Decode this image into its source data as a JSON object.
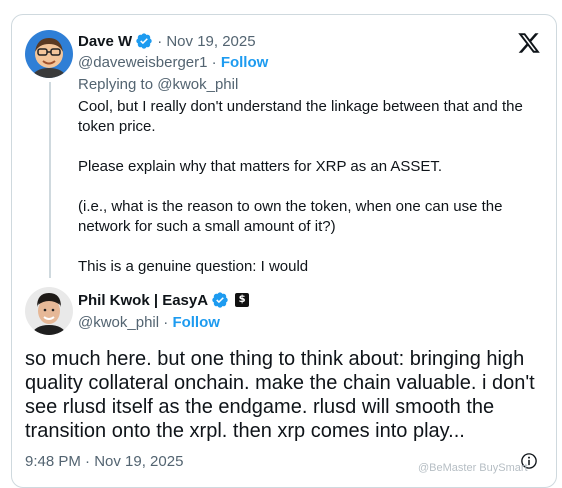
{
  "quoted_post": {
    "author_name": "Dave W",
    "date": "· Nov 19, 2025",
    "handle": "@daveweisberger1",
    "dot": "·",
    "follow_label": "Follow",
    "replying_to": "Replying to @kwok_phil",
    "paragraphs": [
      "Cool, but I really don't understand the linkage between that and the token price.",
      "Please explain why that matters for XRP as an ASSET.",
      "(i.e., what is the reason to own the token, when one can use the network for such a small amount of it?)",
      "This is a genuine question:  I would"
    ]
  },
  "main_post": {
    "author_name": "Phil Kwok | EasyA",
    "affiliate_badge": "$",
    "handle": "@kwok_phil",
    "dot": "·",
    "follow_label": "Follow",
    "text": "so much here. but one thing to think about: bringing high quality collateral onchain. make the chain valuable. i don't see rlusd itself as the endgame. rlusd will smooth the transition onto the xrpl. then xrp comes into play...",
    "timestamp": "9:48 PM · Nov 19, 2025"
  },
  "watermark": "@BeMaster BuySmart",
  "icons": {
    "logo": "x-logo-icon",
    "verified": "verified-badge-icon",
    "info": "info-icon"
  },
  "colors": {
    "accent": "#1d9bf0",
    "text": "#0f1419",
    "secondary": "#536471",
    "border": "#cfd9de"
  }
}
